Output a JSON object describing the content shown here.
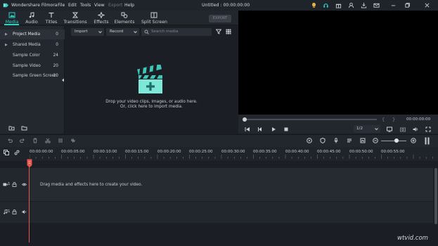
{
  "app": {
    "name": "Wondershare Filmora",
    "document_title": "Untitled : 00:00:00:00"
  },
  "menu": [
    "File",
    "Edit",
    "Tools",
    "View",
    "Export",
    "Help"
  ],
  "toolbar": {
    "tabs": [
      {
        "label": "Media",
        "icon": "media-icon",
        "active": true
      },
      {
        "label": "Audio",
        "icon": "audio-note-icon"
      },
      {
        "label": "Titles",
        "icon": "titles-t-icon"
      },
      {
        "label": "Transitions",
        "icon": "transitions-icon"
      },
      {
        "label": "Effects",
        "icon": "effects-sparkle-icon"
      },
      {
        "label": "Elements",
        "icon": "elements-shapes-icon"
      },
      {
        "label": "Split Screen",
        "icon": "split-screen-icon"
      }
    ],
    "export_label": "EXPORT"
  },
  "sidebar": {
    "items": [
      {
        "label": "Project Media",
        "count": "0",
        "arrow": "▶"
      },
      {
        "label": "Shared Media",
        "count": "0",
        "arrow": "▶"
      },
      {
        "label": "Sample Color",
        "count": "24"
      },
      {
        "label": "Sample Video",
        "count": "20"
      },
      {
        "label": "Sample Green Screen",
        "count": "10"
      }
    ]
  },
  "media": {
    "import_label": "Import",
    "record_label": "Record",
    "search_placeholder": "Search media",
    "drop_line1": "Drop your video clips, images, or audio here.",
    "drop_line2": "Or, click here to import media."
  },
  "preview": {
    "time": "00:00:00:00",
    "mark_in": "{",
    "mark_out": "}",
    "ratio": "1/2"
  },
  "timeline": {
    "ticks": [
      "00:00:00:00",
      "00:00:05:00",
      "00:00:10:00",
      "00:00:15:00",
      "00:00:20:00",
      "00:00:25:00",
      "00:00:30:00",
      "00:00:35:00",
      "00:00:40:00",
      "00:00:45:00",
      "00:00:50:00",
      "00:00:55:00"
    ],
    "hint": "Drag media and effects here to create your video.",
    "video_track_label": "1",
    "audio_track_label": "1"
  },
  "watermark": "wtvid.com",
  "colors": {
    "accent": "#2fd2c5",
    "playhead": "#e5574c",
    "background": "#1b1e24",
    "panel": "#22262d"
  }
}
